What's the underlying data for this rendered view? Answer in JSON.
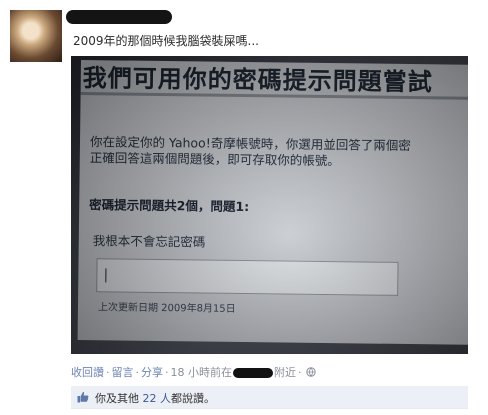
{
  "post": {
    "text": "2009年的那個時候我腦袋裝屎嗎..."
  },
  "photo": {
    "title": "我們可用你的密碼提示問題嘗試",
    "description_line1": "你在設定你的 Yahoo!奇摩帳號時，你選用並回答了兩個密",
    "description_line2": "正確回答這兩個問題後，即可存取你的帳號。",
    "question_heading": "密碼提示問題共2個，問題1:",
    "question": "我根本不會忘記密碼",
    "last_updated": "上次更新日期 2009年8月15日"
  },
  "actions": {
    "comment": "收回讚",
    "reply": "留言",
    "share": "分享",
    "time": "18 小時前在",
    "nearby": "附近",
    "separator": "·"
  },
  "likes": {
    "prefix": "你及其他",
    "count_link": "22 人",
    "suffix": "都說讚。"
  }
}
